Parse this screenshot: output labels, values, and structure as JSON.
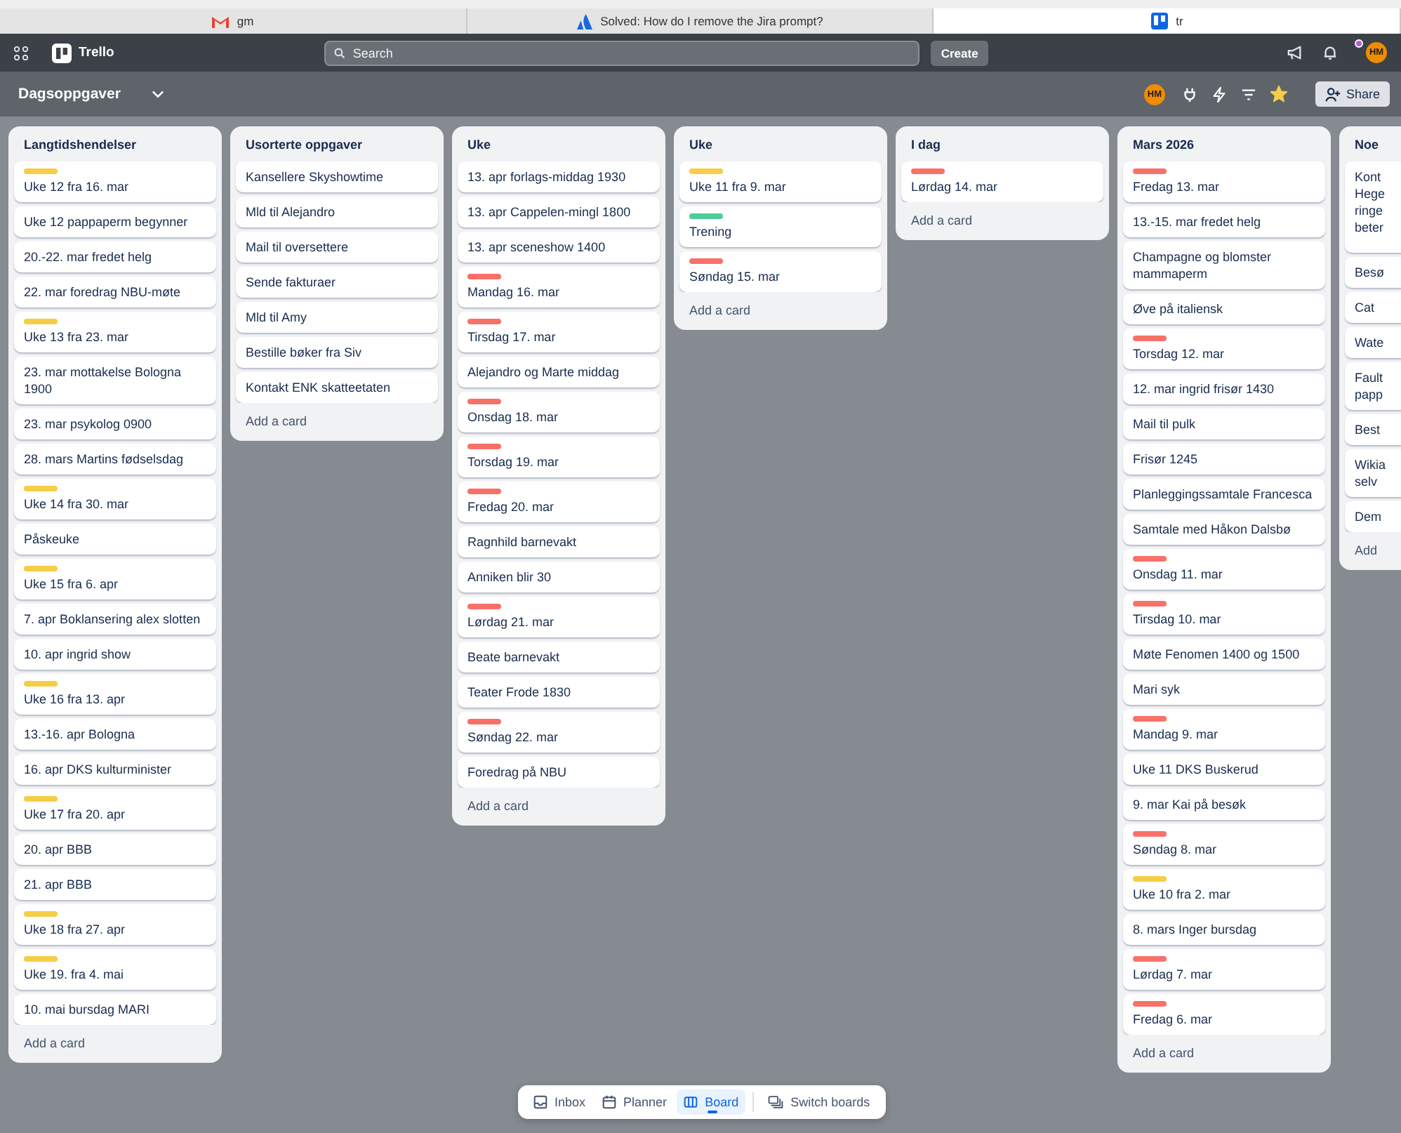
{
  "browser_tabs": [
    {
      "label": "gm",
      "kind": "mail",
      "selected": false
    },
    {
      "label": "Solved: How do I remove the Jira prompt?",
      "kind": "forum",
      "selected": false
    },
    {
      "label": "tr",
      "kind": "board",
      "selected": true
    }
  ],
  "app_bar": {
    "brand": "Trello",
    "search_placeholder": "Search",
    "create": "Create",
    "notification_dot": true,
    "avatar": "HM"
  },
  "board": {
    "title": "Dagsoppgaver",
    "member": "HM",
    "starred": true,
    "share": "Share"
  },
  "lists": [
    {
      "title": "Langtidshendelser",
      "add": "Add a card",
      "cards": [
        {
          "text": "Uke 12 fra 16. mar",
          "color": "#f5cd47"
        },
        {
          "text": "Uke 12 pappaperm begynner"
        },
        {
          "text": "20.-22. mar fredet helg"
        },
        {
          "text": "22. mar foredrag NBU-møte"
        },
        {
          "text": "Uke 13 fra 23. mar",
          "color": "#f5cd47"
        },
        {
          "text": "23. mar mottakelse Bologna 1900"
        },
        {
          "text": "23. mar psykolog 0900"
        },
        {
          "text": "28. mars Martins fødselsdag"
        },
        {
          "text": "Uke 14 fra 30. mar",
          "color": "#f5cd47"
        },
        {
          "text": "Påskeuke"
        },
        {
          "text": "Uke 15 fra 6. apr",
          "color": "#f5cd47"
        },
        {
          "text": "7. apr Boklansering alex slotten"
        },
        {
          "text": "10. apr ingrid show"
        },
        {
          "text": "Uke 16 fra 13. apr",
          "color": "#f5cd47"
        },
        {
          "text": "13.-16. apr Bologna"
        },
        {
          "text": "16. apr DKS kulturminister"
        },
        {
          "text": "Uke 17 fra 20. apr",
          "color": "#f5cd47"
        },
        {
          "text": "20. apr BBB"
        },
        {
          "text": "21. apr BBB"
        },
        {
          "text": "Uke 18 fra 27. apr",
          "color": "#f5cd47"
        },
        {
          "text": "Uke 19. fra 4. mai",
          "color": "#f5cd47"
        },
        {
          "text": "10. mai bursdag MARI"
        }
      ]
    },
    {
      "title": "Usorterte oppgaver",
      "add": "Add a card",
      "cards": [
        {
          "text": "Kansellere Skyshowtime"
        },
        {
          "text": "Mld til Alejandro"
        },
        {
          "text": "Mail til oversettere"
        },
        {
          "text": "Sende fakturaer"
        },
        {
          "text": "Mld til Amy"
        },
        {
          "text": "Bestille bøker fra Siv"
        },
        {
          "text": "Kontakt ENK skatteetaten"
        }
      ]
    },
    {
      "title": "Uke",
      "add": "Add a card",
      "cards": [
        {
          "text": "13. apr forlags-middag 1930"
        },
        {
          "text": "13. apr Cappelen-mingl 1800"
        },
        {
          "text": "13. apr sceneshow 1400"
        },
        {
          "text": "Mandag 16. mar",
          "color": "#f87168"
        },
        {
          "text": "Tirsdag 17. mar",
          "color": "#f87168"
        },
        {
          "text": "Alejandro og Marte middag"
        },
        {
          "text": "Onsdag 18. mar",
          "color": "#f87168"
        },
        {
          "text": "Torsdag 19. mar",
          "color": "#f87168"
        },
        {
          "text": "Fredag 20. mar",
          "color": "#f87168"
        },
        {
          "text": "Ragnhild barnevakt"
        },
        {
          "text": "Anniken blir 30"
        },
        {
          "text": "Lørdag 21. mar",
          "color": "#f87168"
        },
        {
          "text": "Beate barnevakt"
        },
        {
          "text": "Teater Frode 1830"
        },
        {
          "text": "Søndag 22. mar",
          "color": "#f87168"
        },
        {
          "text": "Foredrag på NBU"
        }
      ]
    },
    {
      "title": "Uke",
      "add": "Add a card",
      "cards": [
        {
          "text": "Uke 11 fra 9. mar",
          "color": "#f5cd47"
        },
        {
          "text": "Trening",
          "color": "#4bce97"
        },
        {
          "text": "Søndag 15. mar",
          "color": "#f87168"
        }
      ]
    },
    {
      "title": "I dag",
      "add": "Add a card",
      "cards": [
        {
          "text": "Lørdag 14. mar",
          "color": "#f87168"
        }
      ]
    },
    {
      "title": "Mars 2026",
      "add": "Add a card",
      "cards": [
        {
          "text": "Fredag 13. mar",
          "color": "#f87168"
        },
        {
          "text": "13.-15. mar fredet helg"
        },
        {
          "text": "Champagne og blomster mammaperm"
        },
        {
          "text": "Øve på italiensk"
        },
        {
          "text": "Torsdag 12. mar",
          "color": "#f87168"
        },
        {
          "text": "12. mar ingrid frisør 1430"
        },
        {
          "text": "Mail til pulk"
        },
        {
          "text": "Frisør 1245"
        },
        {
          "text": "Planleggingssamtale Francesca"
        },
        {
          "text": "Samtale med Håkon Dalsbø"
        },
        {
          "text": "Onsdag 11. mar",
          "color": "#f87168"
        },
        {
          "text": "Tirsdag 10. mar",
          "color": "#f87168"
        },
        {
          "text": "Møte Fenomen 1400 og 1500"
        },
        {
          "text": "Mari syk"
        },
        {
          "text": "Mandag 9. mar",
          "color": "#f87168"
        },
        {
          "text": "Uke 11 DKS Buskerud"
        },
        {
          "text": "9. mar Kai på besøk"
        },
        {
          "text": "Søndag 8. mar",
          "color": "#f87168"
        },
        {
          "text": "Uke 10 fra 2. mar",
          "color": "#f5cd47"
        },
        {
          "text": "8. mars Inger bursdag"
        },
        {
          "text": "Lørdag 7. mar",
          "color": "#f87168"
        },
        {
          "text": "Fredag 6. mar",
          "color": "#f87168"
        }
      ]
    },
    {
      "title": "Noe",
      "add": "Add",
      "cards": [
        {
          "text": "Kont\nHege\nringe\nbeter",
          "kind": "tall"
        },
        {
          "text": "Besø"
        },
        {
          "text": "Cat"
        },
        {
          "text": "Wate"
        },
        {
          "text": "Fault\npapp"
        },
        {
          "text": "Best"
        },
        {
          "text": "Wikia\nselv"
        },
        {
          "text": "Dem"
        }
      ]
    }
  ],
  "bottom_nav": [
    {
      "label": "Inbox",
      "kind": "inbox",
      "selected": false
    },
    {
      "label": "Planner",
      "kind": "planner",
      "selected": false
    },
    {
      "label": "Board",
      "kind": "board",
      "selected": true
    },
    {
      "label": "Switch boards",
      "kind": "switch",
      "selected": false
    }
  ]
}
